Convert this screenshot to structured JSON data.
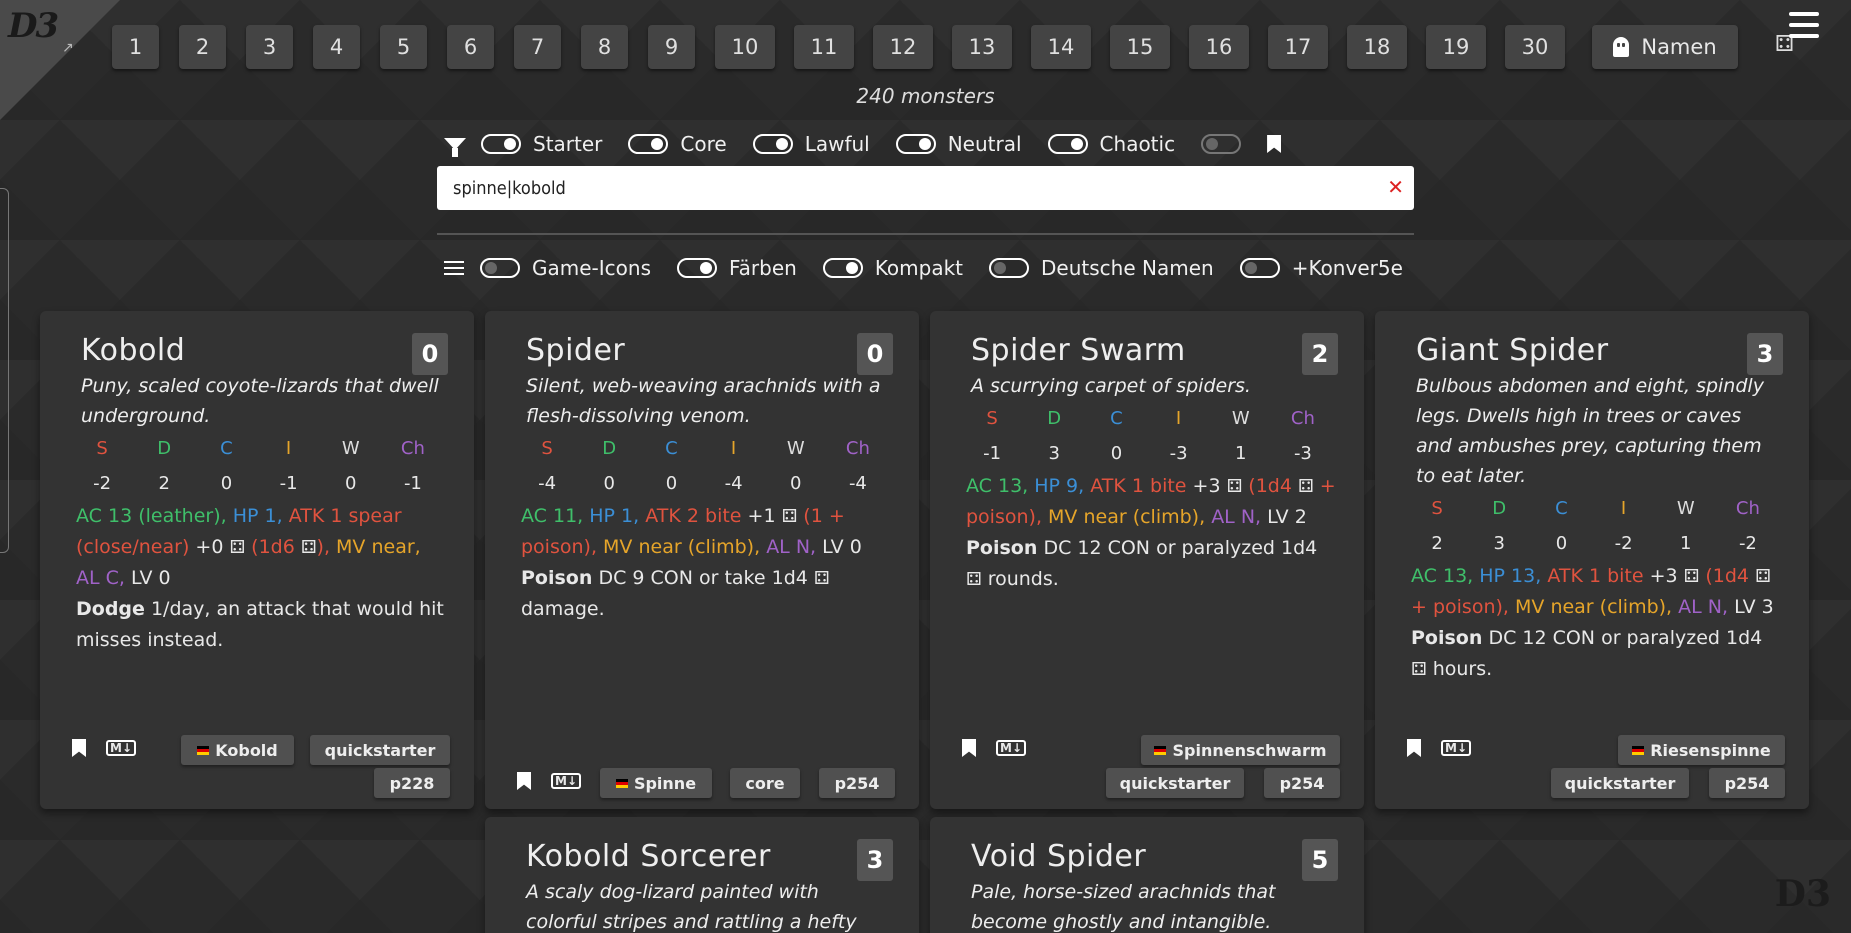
{
  "logo": {
    "text": "D3",
    "bottom_text": "D3",
    "arrow": "↗"
  },
  "levels": [
    "1",
    "2",
    "3",
    "4",
    "5",
    "6",
    "7",
    "8",
    "9",
    "10",
    "11",
    "12",
    "13",
    "14",
    "15",
    "16",
    "17",
    "18",
    "19",
    "30"
  ],
  "namen_button": {
    "label": "Namen",
    "icon": "ghost-icon"
  },
  "dice_icon": "⚃",
  "monster_count": "240 monsters",
  "filters": {
    "starter": "Starter",
    "core": "Core",
    "lawful": "Lawful",
    "neutral": "Neutral",
    "chaotic": "Chaotic"
  },
  "search": {
    "value": "spinne|kobold",
    "clear": "✕"
  },
  "options": {
    "game_icons": "Game-Icons",
    "faerben": "Färben",
    "kompakt": "Kompakt",
    "deutsche_namen": "Deutsche Namen",
    "konver": "+Konver5e"
  },
  "stat_labels": [
    "S",
    "D",
    "C",
    "I",
    "W",
    "Ch"
  ],
  "cards": [
    {
      "name": "Kobold",
      "level": "0",
      "desc": "Puny, scaled coyote-lizards that dwell underground.",
      "stats": [
        "-2",
        "2",
        "0",
        "-1",
        "0",
        "-1"
      ],
      "ac": "AC",
      "ac_val": "13 (leather),",
      "hp": "HP",
      "hp_val": "1,",
      "atk": "ATK",
      "atk_val": "1 spear (close/near)",
      "atk_bonus": "+0",
      "atk_dmg_open": "(1d6",
      "atk_dmg_close": "),",
      "mv": "MV",
      "mv_val": "near,",
      "al": "AL",
      "al_val": "C,",
      "lv": "LV",
      "lv_val": "0",
      "ability": "Dodge",
      "ability_text": "1/day, an attack that would hit misses instead.",
      "german": "Kobold",
      "source": "quickstarter",
      "page": "p228"
    },
    {
      "name": "Spider",
      "level": "0",
      "desc": "Silent, web-weaving arachnids with a flesh-dissolving venom.",
      "stats": [
        "-4",
        "0",
        "0",
        "-4",
        "0",
        "-4"
      ],
      "ac": "AC",
      "ac_val": "11,",
      "hp": "HP",
      "hp_val": "1,",
      "atk": "ATK",
      "atk_val": "2 bite",
      "atk_bonus": "+1",
      "atk_dmg": "(1 + poison),",
      "mv": "MV",
      "mv_val": "near (climb),",
      "al": "AL",
      "al_val": "N,",
      "lv": "LV",
      "lv_val": "0",
      "ability": "Poison",
      "ability_text": "DC 9 CON or take 1d4",
      "ability_tail": "damage.",
      "german": "Spinne",
      "source": "core",
      "page": "p254"
    },
    {
      "name": "Spider Swarm",
      "level": "2",
      "desc": "A scurrying carpet of spiders.",
      "stats": [
        "-1",
        "3",
        "0",
        "-3",
        "1",
        "-3"
      ],
      "ac": "AC",
      "ac_val": "13,",
      "hp": "HP",
      "hp_val": "9,",
      "atk": "ATK",
      "atk_val": "1 bite",
      "atk_bonus": "+3",
      "atk_dmg_open": "(1d4",
      "atk_dmg_close": "+ poison),",
      "mv": "MV",
      "mv_val": "near (climb),",
      "al": "AL",
      "al_val": "N,",
      "lv": "LV",
      "lv_val": "2",
      "ability": "Poison",
      "ability_text": "DC 12 CON or paralyzed 1d4",
      "ability_tail": "rounds.",
      "german": "Spinnenschwarm",
      "source": "quickstarter",
      "page": "p254"
    },
    {
      "name": "Giant Spider",
      "level": "3",
      "desc": "Bulbous abdomen and eight, spindly legs. Dwells high in trees or caves and ambushes prey, capturing them to eat later.",
      "stats": [
        "2",
        "3",
        "0",
        "-2",
        "1",
        "-2"
      ],
      "ac": "AC",
      "ac_val": "13,",
      "hp": "HP",
      "hp_val": "13,",
      "atk": "ATK",
      "atk_val": "1 bite",
      "atk_bonus": "+3",
      "atk_dmg_open": "(1d4",
      "atk_dmg_close": "+ poison),",
      "mv": "MV",
      "mv_val": "near (climb),",
      "al": "AL",
      "al_val": "N,",
      "lv": "LV",
      "lv_val": "3",
      "ability": "Poison",
      "ability_text": "DC 12 CON or paralyzed 1d4",
      "ability_tail": "hours.",
      "german": "Riesenspinne",
      "source": "quickstarter",
      "page": "p254"
    },
    {
      "name": "Kobold Sorcerer",
      "level": "3",
      "desc": "A scaly dog-lizard painted with colorful stripes and rattling a hefty"
    },
    {
      "name": "Void Spider",
      "level": "5",
      "desc": "Pale, horse-sized arachnids that become ghostly and intangible."
    }
  ]
}
